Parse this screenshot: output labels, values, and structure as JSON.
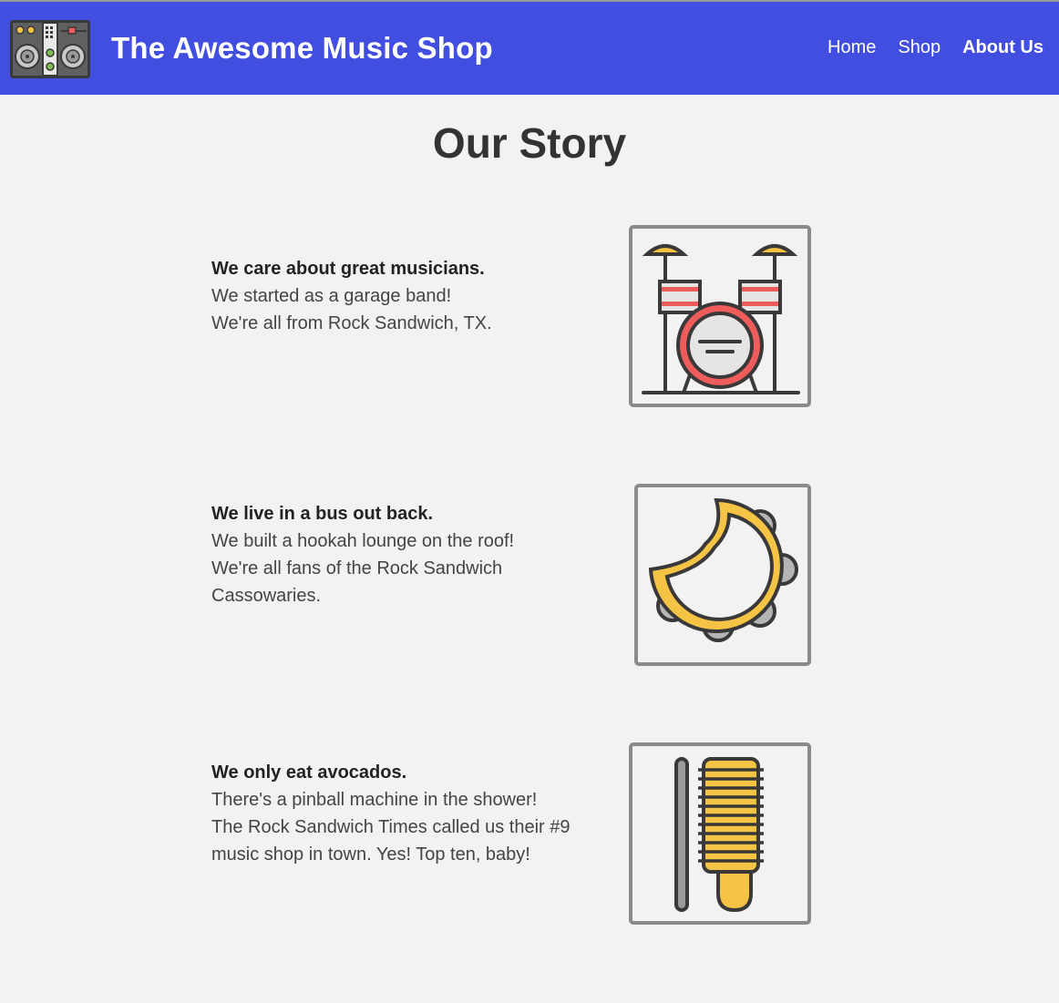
{
  "header": {
    "site_title": "The Awesome Music Shop",
    "logo_icon": "dj-mixer-icon",
    "brand_color": "#414ee0",
    "nav": [
      {
        "label": "Home",
        "active": false
      },
      {
        "label": "Shop",
        "active": false
      },
      {
        "label": "About Us",
        "active": true
      }
    ]
  },
  "main": {
    "title": "Our Story",
    "stories": [
      {
        "heading": "We care about great musicians.",
        "lines": [
          "We started as a garage band!",
          "We're all from Rock Sandwich, TX."
        ],
        "icon": "drum-kit-icon"
      },
      {
        "heading": "We live in a bus out back.",
        "lines": [
          "We built a hookah lounge on the roof!",
          "We're all fans of the Rock Sandwich",
          "Cassowaries."
        ],
        "icon": "tambourine-icon"
      },
      {
        "heading": "We only eat avocados.",
        "lines": [
          "There's a pinball machine in the shower!",
          "The Rock Sandwich Times called us their #9",
          "music shop in town. Yes! Top ten, baby!"
        ],
        "icon": "guiro-icon"
      }
    ]
  }
}
